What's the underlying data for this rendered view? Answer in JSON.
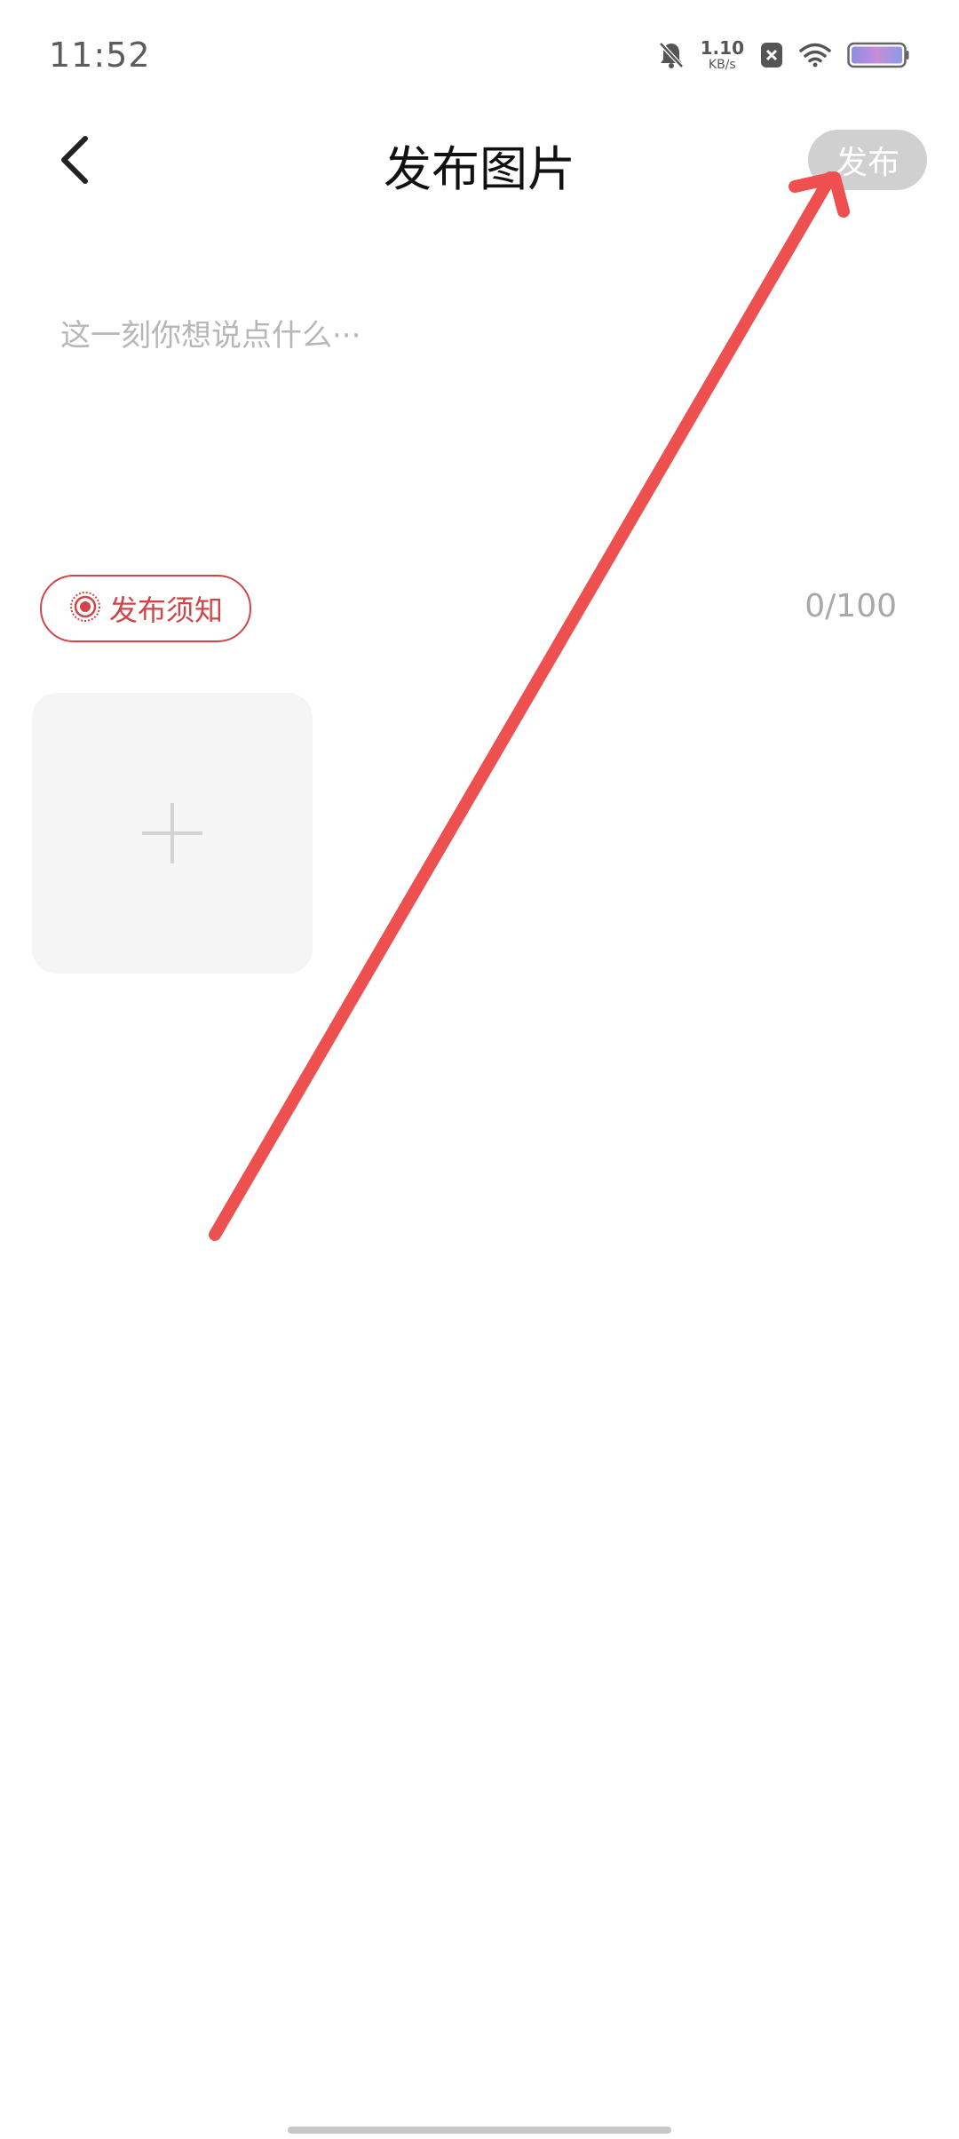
{
  "status_bar": {
    "time": "11:52",
    "net_speed_value": "1.10",
    "net_speed_unit": "KB/s",
    "icons": [
      "bell-muted-icon",
      "net-speed",
      "close-box-icon",
      "wifi-icon",
      "battery-icon"
    ]
  },
  "header": {
    "title": "发布图片",
    "publish_label": "发布",
    "back_icon": "chevron-left-icon"
  },
  "editor": {
    "placeholder": "这一刻你想说点什么···",
    "value": ""
  },
  "notice": {
    "label": "发布须知",
    "icon": "concentric-circle-icon"
  },
  "counter": {
    "text": "0/100"
  },
  "add_image": {
    "icon": "plus-icon"
  },
  "colors": {
    "accent": "#cf4548",
    "publish_disabled_bg": "#d0d0d0",
    "tile_bg": "#f5f5f5",
    "placeholder": "#b7b7b7",
    "annotation": "#ee5050"
  }
}
